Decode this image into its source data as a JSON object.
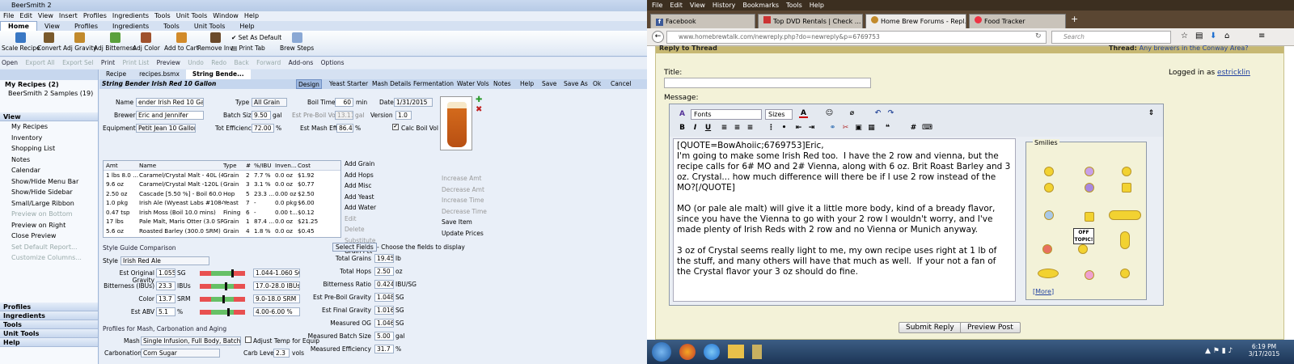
{
  "beersmith": {
    "title": "BeerSmith 2",
    "menu": [
      "File",
      "Edit",
      "View",
      "Insert",
      "Profiles",
      "Ingredients",
      "Tools",
      "Unit Tools",
      "Window",
      "Help"
    ],
    "ribbon_tabs": [
      "Home",
      "View",
      "Profiles",
      "Ingredients",
      "Tools",
      "Unit Tools",
      "Help"
    ],
    "ribbon_buttons": [
      "Scale Recipe",
      "Convert",
      "Adj Gravity",
      "Adj Bitterness",
      "Adj Color",
      "Add to Cart",
      "Remove Inv",
      "Print Tab",
      "Brew Steps"
    ],
    "ribbon_small": [
      "Set As Default",
      "Print Tab"
    ],
    "toolbar": [
      "Open",
      "Export All",
      "Export Sel",
      "Print",
      "Print List",
      "Preview",
      "Undo",
      "Redo",
      "Back",
      "Forward",
      "Add-ons",
      "Options"
    ],
    "sidebar": {
      "header": "My Recipes (2)",
      "tree_item": "BeerSmith 2 Samples (19)",
      "view_header": "View",
      "items": [
        "My Recipes",
        "Inventory",
        "Shopping List",
        "Notes",
        "Calendar",
        "Show/Hide Menu Bar",
        "Show/Hide Sidebar",
        "Small/Large Ribbon",
        "Preview on Bottom",
        "Preview on Right",
        "Close Preview",
        "Set Default Report...",
        "Customize Columns..."
      ],
      "groups": [
        "Profiles",
        "Ingredients",
        "Tools",
        "Unit Tools",
        "Help"
      ]
    },
    "doc_tabs": [
      "Recipe",
      "recipes.bsmx",
      "String Bende..."
    ],
    "recipe_name": "String Bender Irish Red 10 Gallon",
    "recipe_buttons": [
      "Design",
      "Yeast Starter",
      "Mash Details",
      "Fermentation",
      "Water Vols",
      "Notes",
      "Help",
      "Save",
      "Save As",
      "Ok",
      "Cancel"
    ],
    "form": {
      "name_label": "Name",
      "name": "ender Irish Red 10 Gallon",
      "type_label": "Type",
      "type": "All Grain",
      "boil_time_label": "Boil Time",
      "boil_time": "60",
      "boil_unit": "min",
      "date_label": "Date",
      "date": "1/31/2015",
      "brewer_label": "Brewer",
      "brewer": "Eric and Jennifer",
      "batch_label": "Batch Size",
      "batch": "9.50",
      "batch_unit": "gal",
      "preboil_label": "Est Pre-Boil Vol",
      "preboil": "13.11",
      "preboil_unit": "gal",
      "version_label": "Version",
      "version": "1.0",
      "equip_label": "Equipment",
      "equip": "Petit Jean 10 Gallon",
      "eff_label": "Tot Efficiency",
      "eff": "72.00",
      "eff_unit": "%",
      "mash_eff_label": "Est Mash Eff",
      "mash_eff": "86.4",
      "mash_eff_unit": "%",
      "calc_label": "Calc Boil Vol"
    },
    "ing_headers": [
      "Amt",
      "Name",
      "Type",
      "#",
      "%/IBU",
      "Inven...",
      "Cost"
    ],
    "ingredients": [
      [
        "1 lbs 8.0 ...",
        "Caramel/Crystal Malt - 40L (4...",
        "Grain",
        "2",
        "7.7 %",
        "0.0 oz",
        "$1.92"
      ],
      [
        "9.6 oz",
        "Caramel/Crystal Malt -120L (...",
        "Grain",
        "3",
        "3.1 %",
        "0.0 oz",
        "$0.77"
      ],
      [
        "2.50 oz",
        "Cascade [5.50 %] - Boil 60.0 ...",
        "Hop",
        "5",
        "23.3 ...",
        "0.00 oz",
        "$2.50"
      ],
      [
        "1.0 pkg",
        "Irish Ale (Wyeast Labs #1084...",
        "Yeast",
        "7",
        "-",
        "0.0 pkg",
        "$6.00"
      ],
      [
        "0.47 tsp",
        "Irish Moss (Boil 10.0 mins)",
        "Fining",
        "6",
        "-",
        "0.00 t...",
        "$0.12"
      ],
      [
        "17 lbs",
        "Pale Malt, Maris Otter (3.0 SR...",
        "Grain",
        "1",
        "87.4 ...",
        "0.0 oz",
        "$21.25"
      ],
      [
        "5.6 oz",
        "Roasted Barley (300.0 SRM)",
        "Grain",
        "4",
        "1.8 %",
        "0.0 oz",
        "$0.45"
      ]
    ],
    "add_actions": [
      "Add Grain",
      "Add Hops",
      "Add Misc",
      "Add Yeast",
      "Add Water",
      "Edit",
      "Delete",
      "Substitute",
      "Grain Pct"
    ],
    "amt_actions": [
      "Increase Amt",
      "Decrease Amt",
      "Increase Time",
      "Decrease Time",
      "Save Item",
      "Update Prices"
    ],
    "style": {
      "heading": "Style Guide Comparison",
      "style_label": "Style",
      "style": "Irish Red Ale",
      "rows": [
        {
          "label": "Est Original Gravity",
          "value": "1.055",
          "unit": "SG",
          "range": "1.044-1.060 SG",
          "pos": 0.72
        },
        {
          "label": "Bitterness (IBUs)",
          "value": "23.3",
          "unit": "IBUs",
          "range": "17.0-28.0 IBUs",
          "pos": 0.58
        },
        {
          "label": "Color",
          "value": "13.7",
          "unit": "SRM",
          "range": "9.0-18.0 SRM",
          "pos": 0.52
        },
        {
          "label": "Est ABV",
          "value": "5.1",
          "unit": "%",
          "range": "4.00-6.00 %",
          "pos": 0.62
        }
      ]
    },
    "select_fields": "Select Fields",
    "select_hint": "- Choose the fields to display",
    "stats": [
      {
        "label": "Total Grains",
        "value": "19.45",
        "unit": "lb"
      },
      {
        "label": "Total Hops",
        "value": "2.50",
        "unit": "oz"
      },
      {
        "label": "Bitterness Ratio",
        "value": "0.424",
        "unit": "IBU/SG"
      },
      {
        "label": "Est Pre-Boil Gravity",
        "value": "1.048",
        "unit": "SG"
      },
      {
        "label": "Est Final Gravity",
        "value": "1.016",
        "unit": "SG"
      },
      {
        "label": "Measured OG",
        "value": "1.046",
        "unit": "SG"
      },
      {
        "label": "Measured Batch Size",
        "value": "5.00",
        "unit": "gal"
      },
      {
        "label": "Measured Efficiency",
        "value": "31.7",
        "unit": "%"
      }
    ],
    "profiles_heading": "Profiles for Mash, Carbonation and Aging",
    "mash_label": "Mash",
    "mash": "Single Infusion, Full Body, Batch S",
    "adjust_temp": "Adjust Temp for Equip",
    "carb_label": "Carbonation",
    "carb": "Corn Sugar",
    "carb_level_label": "Carb Level",
    "carb_level": "2.3",
    "carb_unit": "vols"
  },
  "browser": {
    "menu": [
      "File",
      "Edit",
      "View",
      "History",
      "Bookmarks",
      "Tools",
      "Help"
    ],
    "tabs": [
      "Facebook",
      "Top DVD Rentals | Check ...",
      "Home Brew Forums - Repl...",
      "Food Tracker"
    ],
    "url": "www.homebrewtalk.com/newreply.php?do=newreply&p=6769753",
    "search_placeholder": "Search",
    "forum": {
      "heading": "Reply to Thread",
      "thread_label": "Thread:",
      "thread": "Any brewers in the Conway Area?",
      "title_label": "Title:",
      "logged_in": "Logged in as",
      "user": "estricklin",
      "message_label": "Message:",
      "font_select": "Fonts",
      "size_select": "Sizes",
      "message": "[QUOTE=BowAhoiic;6769753]Eric,\nI'm going to make some Irish Red too.  I have the 2 row and vienna, but the recipe calls for 6# MO and 2# Vienna, along with 6 oz. Brit Roast Barley and 3 oz. Crystal... how much difference will there be if I use 2 row instead of the MO?[/QUOTE]\n\nMO (or pale ale malt) will give it a little more body, kind of a bready flavor, since you have the Vienna to go with your 2 row I wouldn't worry, and I've made plenty of Irish Reds with 2 row and no Vienna or Munich anyway.\n\n3 oz of Crystal seems really light to me, my own recipe uses right at 1 lb of the stuff, and many others will have that much as well.  If your not a fan of the Crystal flavor your 3 oz should do fine.",
      "smilies_label": "Smilies",
      "off_topic": "OFF TOPIC!",
      "more": "More",
      "submit": "Submit Reply",
      "preview": "Preview Post"
    },
    "clock_time": "6:19 PM",
    "clock_date": "3/17/2015"
  },
  "colors": {
    "ribbon_bg": "#dde7f4",
    "forum_bg": "#f3f2d8",
    "taskbar": "#1c3556"
  }
}
